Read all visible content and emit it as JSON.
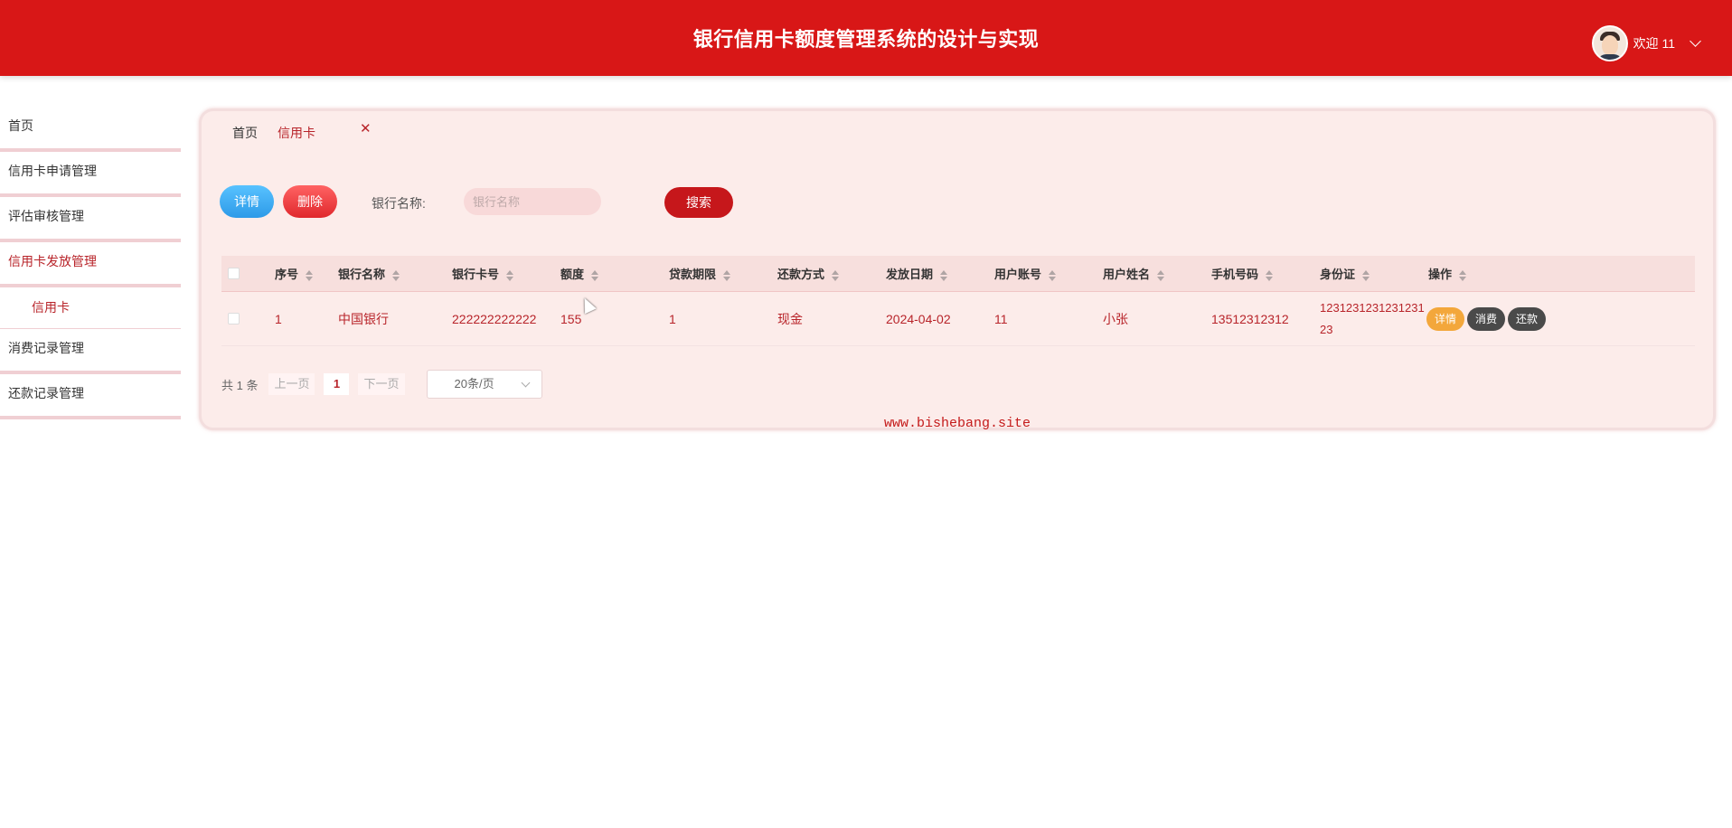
{
  "header": {
    "title": "银行信用卡额度管理系统的设计与实现",
    "welcome": "欢迎 11",
    "color": "#d81717"
  },
  "sidebar": {
    "items": [
      {
        "label": "首页"
      },
      {
        "label": "信用卡申请管理"
      },
      {
        "label": "评估审核管理"
      },
      {
        "label": "信用卡发放管理"
      },
      {
        "label": "信用卡"
      },
      {
        "label": "消费记录管理"
      },
      {
        "label": "还款记录管理"
      }
    ]
  },
  "tabs": [
    {
      "label": "首页"
    },
    {
      "label": "信用卡"
    }
  ],
  "toolbar": {
    "detail_label": "详情",
    "delete_label": "删除",
    "search_label": "银行名称:",
    "search_placeholder": "银行名称",
    "search_button": "搜索"
  },
  "table": {
    "columns": [
      "序号",
      "银行名称",
      "银行卡号",
      "额度",
      "贷款期限",
      "还款方式",
      "发放日期",
      "用户账号",
      "用户姓名",
      "手机号码",
      "身份证",
      "操作"
    ],
    "rows": [
      {
        "index": "1",
        "bank_name": "中国银行",
        "card_no": "222222222222",
        "limit": "155",
        "term": "1",
        "repay_method": "现金",
        "issue_date": "2024-04-02",
        "account": "11",
        "user_name": "小张",
        "phone": "13512312312",
        "id_card": "123123123123123123",
        "actions": {
          "detail": "详情",
          "consume": "消费",
          "repay": "还款"
        }
      }
    ]
  },
  "pagination": {
    "total": "共 1 条",
    "prev": "上一页",
    "page": "1",
    "next": "下一页",
    "page_size": "20条/页"
  },
  "watermark": "www.bishebang.site"
}
